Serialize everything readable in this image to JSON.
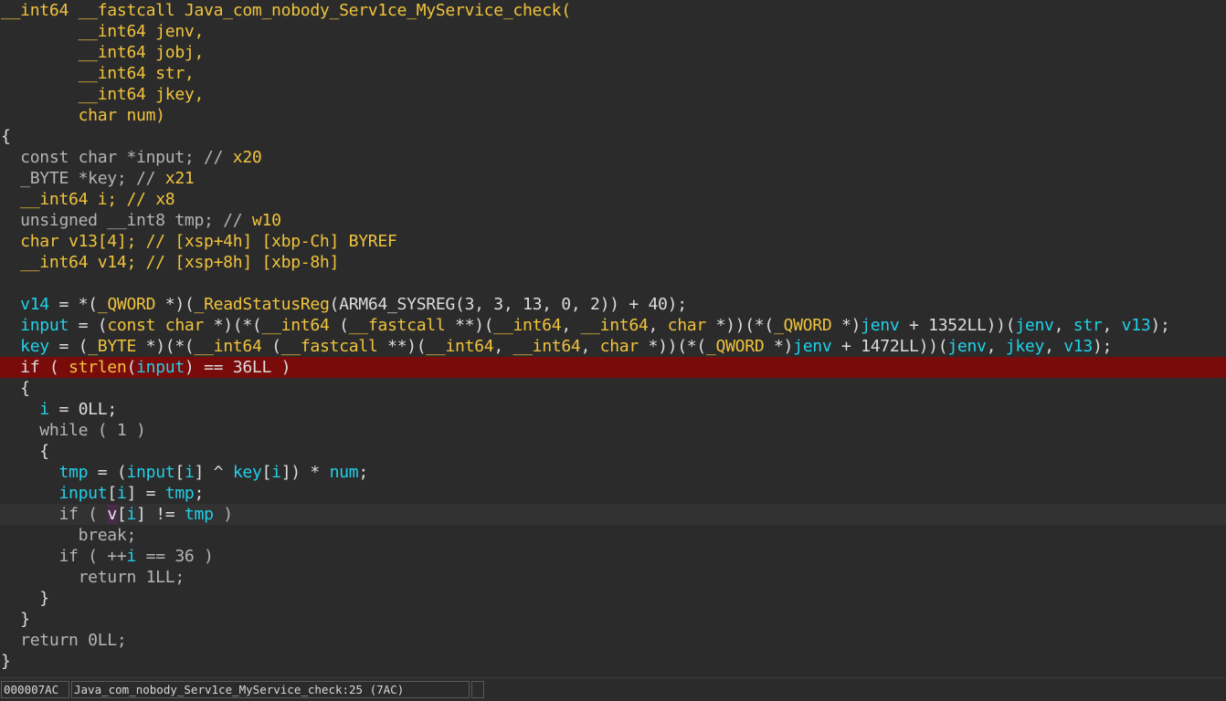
{
  "code_lines": [
    {
      "bg": "",
      "tokens": [
        {
          "t": "__int64 __fastcall Java_com_nobody_Serv1ce_MyService_check(",
          "c": "y"
        }
      ]
    },
    {
      "bg": "",
      "tokens": [
        {
          "t": "        __int64 jenv,",
          "c": "y"
        }
      ]
    },
    {
      "bg": "",
      "tokens": [
        {
          "t": "        __int64 jobj,",
          "c": "y"
        }
      ]
    },
    {
      "bg": "",
      "tokens": [
        {
          "t": "        __int64 str,",
          "c": "y"
        }
      ]
    },
    {
      "bg": "",
      "tokens": [
        {
          "t": "        __int64 jkey,",
          "c": "y"
        }
      ]
    },
    {
      "bg": "",
      "tokens": [
        {
          "t": "        char num)",
          "c": "y"
        }
      ]
    },
    {
      "bg": "",
      "tokens": [
        {
          "t": "{",
          "c": "d"
        }
      ]
    },
    {
      "bg": "",
      "tokens": [
        {
          "t": "  const char *input; // ",
          "c": "g"
        },
        {
          "t": "x20",
          "c": "y"
        }
      ]
    },
    {
      "bg": "",
      "tokens": [
        {
          "t": "  _BYTE *key; // ",
          "c": "g"
        },
        {
          "t": "x21",
          "c": "y"
        }
      ]
    },
    {
      "bg": "",
      "tokens": [
        {
          "t": "  __int64 i; // ",
          "c": "y"
        },
        {
          "t": "x8",
          "c": "y"
        }
      ]
    },
    {
      "bg": "",
      "tokens": [
        {
          "t": "  unsigned __int8 tmp; // ",
          "c": "g"
        },
        {
          "t": "w10",
          "c": "y"
        }
      ]
    },
    {
      "bg": "",
      "tokens": [
        {
          "t": "  char v13[4]; // [xsp+4h] [xbp-Ch] BYREF",
          "c": "y"
        }
      ]
    },
    {
      "bg": "",
      "tokens": [
        {
          "t": "  __int64 v14; // [xsp+8h] [xbp-8h]",
          "c": "y"
        }
      ]
    },
    {
      "bg": "",
      "tokens": [
        {
          "t": "",
          "c": "d"
        }
      ]
    },
    {
      "bg": "",
      "tokens": [
        {
          "t": "  ",
          "c": "d"
        },
        {
          "t": "v14",
          "c": "c"
        },
        {
          "t": " = *(",
          "c": "d"
        },
        {
          "t": "_QWORD",
          "c": "y"
        },
        {
          "t": " *)(",
          "c": "d"
        },
        {
          "t": "_ReadStatusReg",
          "c": "y"
        },
        {
          "t": "(ARM64_SYSREG(3, 3, 13, 0, 2)) + 40);",
          "c": "d"
        }
      ]
    },
    {
      "bg": "",
      "tokens": [
        {
          "t": "  ",
          "c": "d"
        },
        {
          "t": "input",
          "c": "c"
        },
        {
          "t": " = (",
          "c": "d"
        },
        {
          "t": "const char",
          "c": "y"
        },
        {
          "t": " *)(*(",
          "c": "d"
        },
        {
          "t": "__int64",
          "c": "y"
        },
        {
          "t": " (",
          "c": "d"
        },
        {
          "t": "__fastcall",
          "c": "y"
        },
        {
          "t": " **)(",
          "c": "d"
        },
        {
          "t": "__int64",
          "c": "y"
        },
        {
          "t": ", ",
          "c": "d"
        },
        {
          "t": "__int64",
          "c": "y"
        },
        {
          "t": ", ",
          "c": "d"
        },
        {
          "t": "char",
          "c": "y"
        },
        {
          "t": " *))(*(",
          "c": "d"
        },
        {
          "t": "_QWORD",
          "c": "y"
        },
        {
          "t": " *)",
          "c": "d"
        },
        {
          "t": "jenv",
          "c": "c"
        },
        {
          "t": " + 1352LL))(",
          "c": "d"
        },
        {
          "t": "jenv",
          "c": "c"
        },
        {
          "t": ", ",
          "c": "d"
        },
        {
          "t": "str",
          "c": "c"
        },
        {
          "t": ", ",
          "c": "d"
        },
        {
          "t": "v13",
          "c": "c"
        },
        {
          "t": ");",
          "c": "d"
        }
      ]
    },
    {
      "bg": "",
      "tokens": [
        {
          "t": "  ",
          "c": "d"
        },
        {
          "t": "key",
          "c": "c"
        },
        {
          "t": " = (",
          "c": "d"
        },
        {
          "t": "_BYTE",
          "c": "y"
        },
        {
          "t": " *)(*(",
          "c": "d"
        },
        {
          "t": "__int64",
          "c": "y"
        },
        {
          "t": " (",
          "c": "d"
        },
        {
          "t": "__fastcall",
          "c": "y"
        },
        {
          "t": " **)(",
          "c": "d"
        },
        {
          "t": "__int64",
          "c": "y"
        },
        {
          "t": ", ",
          "c": "d"
        },
        {
          "t": "__int64",
          "c": "y"
        },
        {
          "t": ", ",
          "c": "d"
        },
        {
          "t": "char",
          "c": "y"
        },
        {
          "t": " *))(*(",
          "c": "d"
        },
        {
          "t": "_QWORD",
          "c": "y"
        },
        {
          "t": " *)",
          "c": "d"
        },
        {
          "t": "jenv",
          "c": "c"
        },
        {
          "t": " + 1472LL))(",
          "c": "d"
        },
        {
          "t": "jenv",
          "c": "c"
        },
        {
          "t": ", ",
          "c": "d"
        },
        {
          "t": "jkey",
          "c": "c"
        },
        {
          "t": ", ",
          "c": "d"
        },
        {
          "t": "v13",
          "c": "c"
        },
        {
          "t": ");",
          "c": "d"
        }
      ]
    },
    {
      "bg": "bp",
      "tokens": [
        {
          "t": "  if ( ",
          "c": "d"
        },
        {
          "t": "strlen",
          "c": "y"
        },
        {
          "t": "(",
          "c": "d"
        },
        {
          "t": "input",
          "c": "c"
        },
        {
          "t": ") == 36LL )",
          "c": "d"
        }
      ]
    },
    {
      "bg": "",
      "tokens": [
        {
          "t": "  {",
          "c": "d"
        }
      ]
    },
    {
      "bg": "",
      "tokens": [
        {
          "t": "    ",
          "c": "d"
        },
        {
          "t": "i",
          "c": "c"
        },
        {
          "t": " = 0LL;",
          "c": "d"
        }
      ]
    },
    {
      "bg": "",
      "tokens": [
        {
          "t": "    while ( 1 )",
          "c": "g"
        }
      ]
    },
    {
      "bg": "",
      "tokens": [
        {
          "t": "    {",
          "c": "d"
        }
      ]
    },
    {
      "bg": "",
      "tokens": [
        {
          "t": "      ",
          "c": "d"
        },
        {
          "t": "tmp",
          "c": "c"
        },
        {
          "t": " = (",
          "c": "d"
        },
        {
          "t": "input",
          "c": "c"
        },
        {
          "t": "[",
          "c": "d"
        },
        {
          "t": "i",
          "c": "c"
        },
        {
          "t": "] ^ ",
          "c": "d"
        },
        {
          "t": "key",
          "c": "c"
        },
        {
          "t": "[",
          "c": "d"
        },
        {
          "t": "i",
          "c": "c"
        },
        {
          "t": "]) * ",
          "c": "d"
        },
        {
          "t": "num",
          "c": "c"
        },
        {
          "t": ";",
          "c": "d"
        }
      ]
    },
    {
      "bg": "",
      "tokens": [
        {
          "t": "      ",
          "c": "d"
        },
        {
          "t": "input",
          "c": "c"
        },
        {
          "t": "[",
          "c": "d"
        },
        {
          "t": "i",
          "c": "c"
        },
        {
          "t": "] = ",
          "c": "d"
        },
        {
          "t": "tmp",
          "c": "c"
        },
        {
          "t": ";",
          "c": "d"
        }
      ]
    },
    {
      "bg": "cur",
      "tokens": [
        {
          "t": "      if ( ",
          "c": "g"
        },
        {
          "t": "v",
          "c": "hl"
        },
        {
          "t": "[",
          "c": "d"
        },
        {
          "t": "i",
          "c": "c"
        },
        {
          "t": "] != ",
          "c": "d"
        },
        {
          "t": "tmp",
          "c": "c"
        },
        {
          "t": " )",
          "c": "g"
        }
      ]
    },
    {
      "bg": "",
      "tokens": [
        {
          "t": "        break;",
          "c": "g"
        }
      ]
    },
    {
      "bg": "",
      "tokens": [
        {
          "t": "      if ( ++",
          "c": "g"
        },
        {
          "t": "i",
          "c": "c"
        },
        {
          "t": " == 36 )",
          "c": "g"
        }
      ]
    },
    {
      "bg": "",
      "tokens": [
        {
          "t": "        return 1LL;",
          "c": "g"
        }
      ]
    },
    {
      "bg": "",
      "tokens": [
        {
          "t": "    }",
          "c": "d"
        }
      ]
    },
    {
      "bg": "",
      "tokens": [
        {
          "t": "  }",
          "c": "d"
        }
      ]
    },
    {
      "bg": "",
      "tokens": [
        {
          "t": "  return 0LL;",
          "c": "g"
        }
      ]
    },
    {
      "bg": "",
      "tokens": [
        {
          "t": "}",
          "c": "d"
        }
      ]
    }
  ],
  "status_bar": {
    "address": "000007AC",
    "function_location": "Java_com_nobody_Serv1ce_MyService_check:25 (7AC)",
    "extra": ""
  },
  "colors": {
    "background": "#2b2b2b",
    "keyword_yellow": "#f0c33c",
    "variable_cyan": "#22d0e8",
    "breakpoint_red": "#7a0b0b"
  }
}
